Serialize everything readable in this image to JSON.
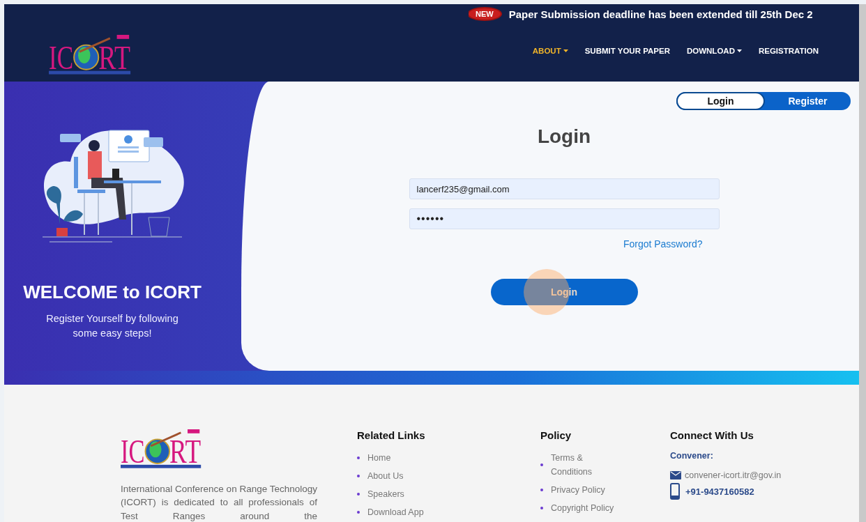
{
  "announcement": {
    "badge": "NEW",
    "text": "Paper Submission deadline has been extended till 25th Dec 2"
  },
  "header": {
    "logo": {
      "letters_before": "IC",
      "letters_after": "RT"
    },
    "nav": [
      {
        "label": "ABOUT",
        "selected": true,
        "dropdown": true
      },
      {
        "label": "SUBMIT YOUR PAPER",
        "selected": false,
        "dropdown": false
      },
      {
        "label": "DOWNLOAD",
        "selected": false,
        "dropdown": true
      },
      {
        "label": "REGISTRATION",
        "selected": false,
        "dropdown": false
      }
    ]
  },
  "welcome": {
    "title": "WELCOME to ICORT",
    "subtitle": "Register Yourself by following some easy steps!"
  },
  "auth_tabs": [
    {
      "label": "Login",
      "selected": true
    },
    {
      "label": "Register",
      "selected": false
    }
  ],
  "login_form": {
    "title": "Login",
    "email": "lancerf235@gmail.com",
    "password": "••••••",
    "forgot_link": "Forgot Password?",
    "submit": "Login"
  },
  "footer": {
    "logo": {
      "letters_before": "IC",
      "letters_after": "RT"
    },
    "about": "International Conference on Range Technology (ICORT) is dedicated to all professionals of Test Ranges around the",
    "columns": [
      {
        "title": "Related Links",
        "links": [
          "Home",
          "About Us",
          "Speakers",
          "Download App"
        ]
      },
      {
        "title": "Policy",
        "links": [
          "Terms & Conditions",
          "Privacy Policy",
          "Copyright Policy"
        ]
      }
    ],
    "contact": {
      "title": "Connect With Us",
      "label": "Convener:",
      "email": "convener-icort.itr@gov.in",
      "phone": "+91-9437160582"
    }
  }
}
